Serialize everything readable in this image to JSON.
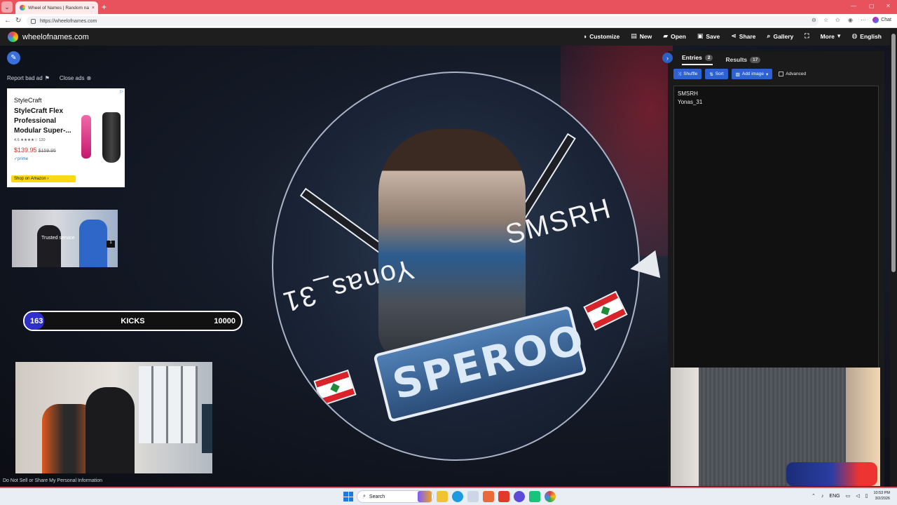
{
  "browser": {
    "tab_title": "Wheel of Names | Random name",
    "tab_close": "×",
    "new_tab": "+",
    "url": "https://wheelofnames.com",
    "chat_label": "Chat"
  },
  "site": {
    "brand": "wheelofnames.com",
    "menu": [
      {
        "icon": "palette-icon",
        "glyph": "◑",
        "label": "Customize"
      },
      {
        "icon": "file-icon",
        "glyph": "▤",
        "label": "New"
      },
      {
        "icon": "folder-icon",
        "glyph": "▰",
        "label": "Open"
      },
      {
        "icon": "save-icon",
        "glyph": "▣",
        "label": "Save"
      },
      {
        "icon": "share-icon",
        "glyph": "⋖",
        "label": "Share"
      },
      {
        "icon": "search-icon",
        "glyph": "⌕",
        "label": "Gallery"
      },
      {
        "icon": "fullscreen-icon",
        "glyph": "⛶",
        "label": ""
      },
      {
        "icon": "chevron-down-icon",
        "glyph": "▾",
        "label": "More"
      },
      {
        "icon": "globe-icon",
        "glyph": "◍",
        "label": "English"
      }
    ]
  },
  "ads": {
    "report_bad_ad": "Report bad ad",
    "close_ads": "Close ads",
    "ad_brand": "StyleCraft",
    "ad_headline": "StyleCraft Flex Professional Modular Super-...",
    "ad_rating": "4.6 ★★★★☆ 120",
    "ad_price": "$139.95",
    "ad_old_price": "$159.95",
    "ad_prime": "✓prime",
    "ad_shop": "Shop on Amazon ›",
    "video_caption": "Trusted service",
    "video_skip": "1"
  },
  "overlay": {
    "kicks_count": "163",
    "kicks_label": "KICKS",
    "kicks_goal": "10000",
    "kicks_progress": 0.0163
  },
  "wheel": {
    "segment_1": "SMSRH",
    "segment_2": "Yonas_31",
    "banner_text": "SPEROO"
  },
  "panel": {
    "tabs": [
      {
        "label": "Entries",
        "badge": "2"
      },
      {
        "label": "Results",
        "badge": "17"
      }
    ],
    "toolbar": {
      "shuffle": "Shuffle",
      "sort": "Sort",
      "add_image": "Add image",
      "advanced": "Advanced"
    },
    "entries": [
      "SMSRH",
      "Yonas_31"
    ]
  },
  "footer": {
    "privacy_link": "Do Not Sell or Share My Personal Information"
  },
  "taskbar": {
    "search_placeholder": "Search",
    "language": "ENG",
    "time": "10:53 PM",
    "date": "3/2/2026"
  },
  "colors": {
    "accent": "#2d62d3",
    "chrome_red": "#e8525c",
    "progress_fill": "#2f2fc9"
  }
}
